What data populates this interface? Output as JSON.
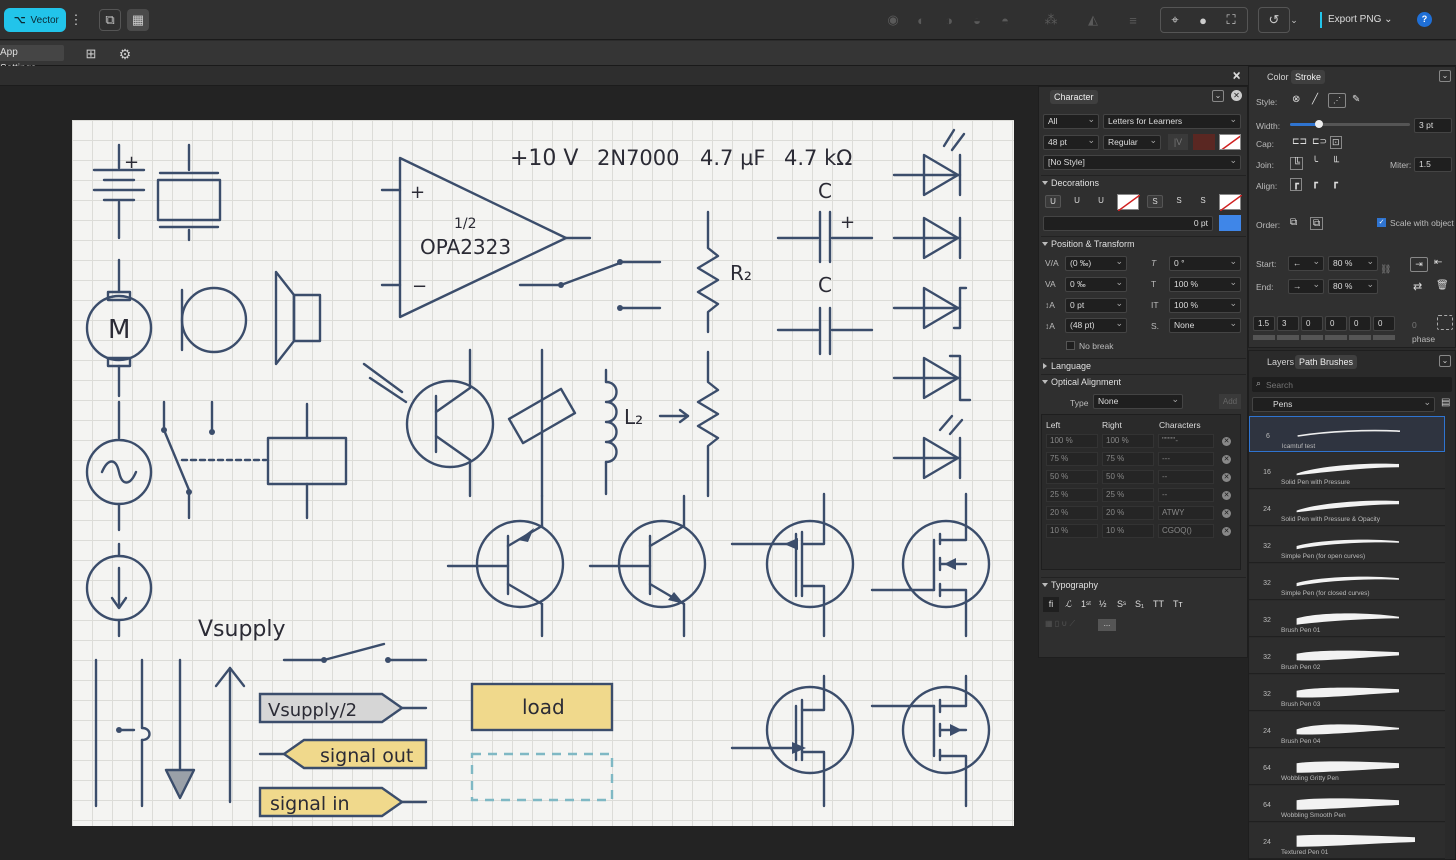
{
  "toolbar": {
    "persona_label": "Vector",
    "export_label": "Export PNG",
    "help_label": "?"
  },
  "secondary": {
    "app_settings_label": "App Settings..."
  },
  "drawing": {
    "labels": {
      "voltage": "+10 V",
      "mosfet": "2N7000",
      "cap_value": "4.7 µF",
      "res_value": "4.7 kΩ",
      "opamp_half": "1/2",
      "opamp_name": "OPA2323",
      "r2": "R₂",
      "l2": "L₂",
      "c1": "C",
      "c2": "C",
      "motor": "M",
      "vsupply": "Vsupply",
      "vsupply_half": "Vsupply/2",
      "signal_out": "signal out",
      "signal_in": "signal in",
      "load": "load"
    }
  },
  "character": {
    "tab": "Character",
    "filter": "All",
    "font": "Letters for Learners",
    "size": "48 pt",
    "weight": "Regular",
    "style": "[No Style]",
    "decorations_title": "Decorations",
    "deco_width": "0 pt",
    "position_title": "Position & Transform",
    "kerning": "(0 ‰)",
    "tracking": "0 ‰",
    "baseline": "0 pt",
    "leading": "(48 pt)",
    "shear": "0 °",
    "vscale": "100 %",
    "hscale": "100 %",
    "caps": "None",
    "nobreak": "No break",
    "language_title": "Language",
    "optical_title": "Optical Alignment",
    "type_label": "Type",
    "type_value": "None",
    "add_label": "Add",
    "col_left": "Left",
    "col_right": "Right",
    "col_chars": "Characters",
    "rows": [
      {
        "left": "100 %",
        "right": "100 %",
        "chars": "\"\"'''''-"
      },
      {
        "left": "75 %",
        "right": "75 %",
        "chars": "---"
      },
      {
        "left": "50 %",
        "right": "50 %",
        "chars": "--"
      },
      {
        "left": "25 %",
        "right": "25 %",
        "chars": "--"
      },
      {
        "left": "20 %",
        "right": "20 %",
        "chars": "ATWY"
      },
      {
        "left": "10 %",
        "right": "10 %",
        "chars": "CGOQ()"
      }
    ],
    "typography_title": "Typography",
    "more": "..."
  },
  "stroke": {
    "tab_color": "Color",
    "tab_stroke": "Stroke",
    "style_label": "Style:",
    "width_label": "Width:",
    "width_value": "3 pt",
    "width_fraction": 0.24,
    "cap_label": "Cap:",
    "join_label": "Join:",
    "miter_label": "Miter:",
    "miter_value": "1.5",
    "align_label": "Align:",
    "order_label": "Order:",
    "scale_label": "Scale with object",
    "start_label": "Start:",
    "end_label": "End:",
    "start_pct": "80 %",
    "end_pct": "80 %",
    "dashes": [
      "1.5",
      "3",
      "0",
      "0",
      "0",
      "0"
    ],
    "dash_extra": "0",
    "phase_label": "phase"
  },
  "layers": {
    "tab_layers": "Layers",
    "tab_brushes": "Path Brushes",
    "search_placeholder": "Search",
    "category": "Pens",
    "brushes": [
      {
        "n": "6",
        "name": "lcamtuf test"
      },
      {
        "n": "16",
        "name": "Solid Pen with Pressure"
      },
      {
        "n": "24",
        "name": "Solid Pen with Pressure & Opacity"
      },
      {
        "n": "32",
        "name": "Simple Pen (for open curves)"
      },
      {
        "n": "32",
        "name": "Simple Pen (for closed curves)"
      },
      {
        "n": "32",
        "name": "Brush Pen 01"
      },
      {
        "n": "32",
        "name": "Brush Pen 02"
      },
      {
        "n": "32",
        "name": "Brush Pen 03"
      },
      {
        "n": "24",
        "name": "Brush Pen 04"
      },
      {
        "n": "64",
        "name": "Wobbling Gritty Pen"
      },
      {
        "n": "64",
        "name": "Wobbling Smooth Pen"
      },
      {
        "n": "24",
        "name": "Textured Pen 01"
      }
    ]
  },
  "colors": {
    "accent": "#2fb6e6",
    "ink": "#3b4d6b",
    "yellow": "#f0d98c",
    "grey_tag": "#d6d6d6",
    "dash_teal": "#7fb8c4",
    "select": "#2f74d0"
  }
}
